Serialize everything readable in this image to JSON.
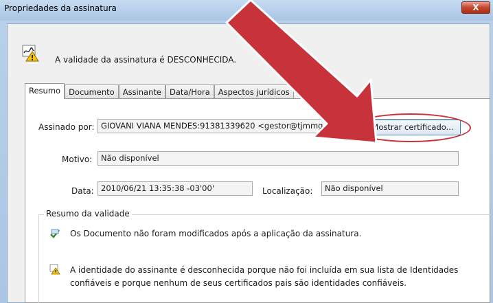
{
  "window": {
    "title": "Propriedades da assinatura",
    "close_label": "X"
  },
  "status": {
    "icon": "signature-warning-icon",
    "text": "A validade da assinatura é DESCONHECIDA."
  },
  "tabs": [
    {
      "label": "Resumo",
      "active": true
    },
    {
      "label": "Documento",
      "active": false
    },
    {
      "label": "Assinante",
      "active": false
    },
    {
      "label": "Data/Hora",
      "active": false
    },
    {
      "label": "Aspectos jurídicos",
      "active": false
    }
  ],
  "summary": {
    "signed_by_label": "Assinado por:",
    "signed_by_value": "GIOVANI VIANA MENDES:91381339620 <gestor@tjmmg.jus.br>",
    "show_cert_button": "Mostrar certificado...",
    "reason_label": "Motivo:",
    "reason_value": "Não disponível",
    "date_label": "Data:",
    "date_value": "2010/06/21 13:35:38 -03'00'",
    "location_label": "Localização:",
    "location_value": "Não disponível"
  },
  "validity": {
    "title": "Resumo da validade",
    "items": [
      {
        "icon": "document-unmodified-icon",
        "text": "Os Documento não foram modificados após a aplicação da assinatura."
      },
      {
        "icon": "identity-warning-icon",
        "line1": "A identidade do assinante é desconhecida porque não foi incluída em sua lista de Identidades",
        "line2": "confiáveis e porque nenhum de seus certificados pais são identidades confiáveis."
      }
    ]
  },
  "colors": {
    "annotation_red": "#c8323a",
    "titlebar": "#b9d1ea",
    "button_border": "#3c7fb1"
  }
}
